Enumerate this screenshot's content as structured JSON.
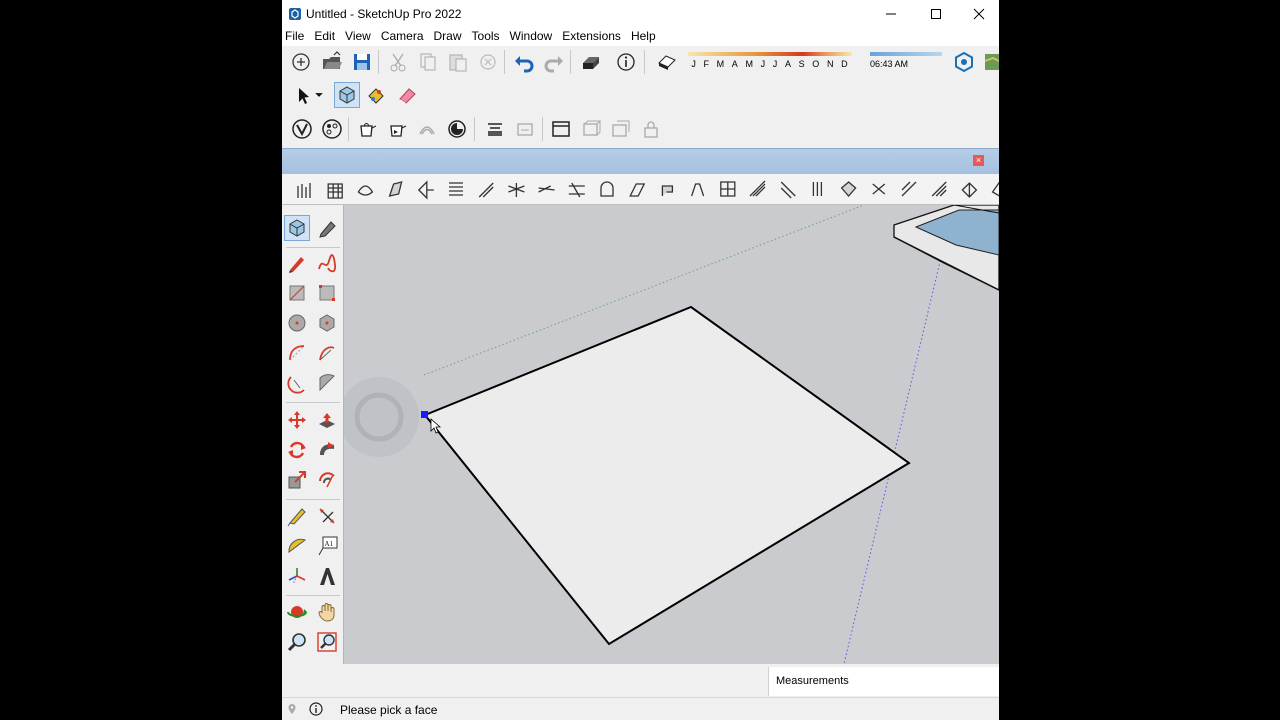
{
  "window": {
    "title": "Untitled - SketchUp Pro 2022",
    "controls": [
      "minimize",
      "maximize",
      "close"
    ]
  },
  "menu": [
    "File",
    "Edit",
    "View",
    "Camera",
    "Draw",
    "Tools",
    "Window",
    "Extensions",
    "Help"
  ],
  "shadows": {
    "months": [
      "J",
      "F",
      "M",
      "A",
      "M",
      "J",
      "J",
      "A",
      "S",
      "O",
      "N",
      "D"
    ],
    "time": "06:43 AM"
  },
  "measurements": {
    "label": "Measurements"
  },
  "status": {
    "text": "Please pick a face"
  },
  "colors": {
    "viewport_bg": "#c9cbcf",
    "face_fill": "#ececec",
    "selection": "#cfe3f7",
    "vertex": "#1a1aff"
  },
  "icons": {
    "standard": [
      "new-file-icon",
      "open-folder-icon",
      "save-icon",
      "cut-icon",
      "copy-icon",
      "paste-icon",
      "erase-icon",
      "undo-icon",
      "redo-icon",
      "print-icon",
      "model-info-icon"
    ],
    "getting_started": [
      "select-arrow-icon",
      "component-icon",
      "paint-bucket-icon",
      "eraser-icon"
    ],
    "styles": [
      "style-v-icon",
      "style-palette-icon",
      "teapot-xray-icon",
      "teapot-back-edges-icon",
      "teapot-wireframe-icon",
      "teapot-hidden-line-icon",
      "teapot-shaded-icon",
      "teapot-textured-icon",
      "teapot-monochrome-icon"
    ]
  }
}
